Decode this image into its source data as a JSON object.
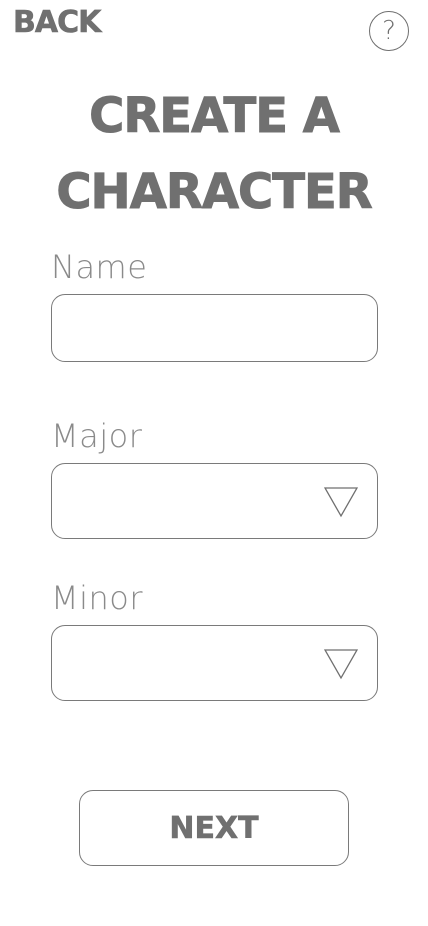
{
  "header": {
    "back_label": "BACK",
    "help_label": "?"
  },
  "title": {
    "line1": "CREATE A",
    "line2": "CHARACTER"
  },
  "form": {
    "name": {
      "label": "Name",
      "value": "",
      "placeholder": ""
    },
    "major": {
      "label": "Major",
      "value": ""
    },
    "minor": {
      "label": "Minor",
      "value": ""
    }
  },
  "actions": {
    "next_label": "NEXT"
  },
  "icons": {
    "help": "question-mark-icon",
    "dropdown": "triangle-down-icon"
  },
  "colors": {
    "text": "#707070",
    "border": "#7a7a7a",
    "background": "#ffffff"
  }
}
